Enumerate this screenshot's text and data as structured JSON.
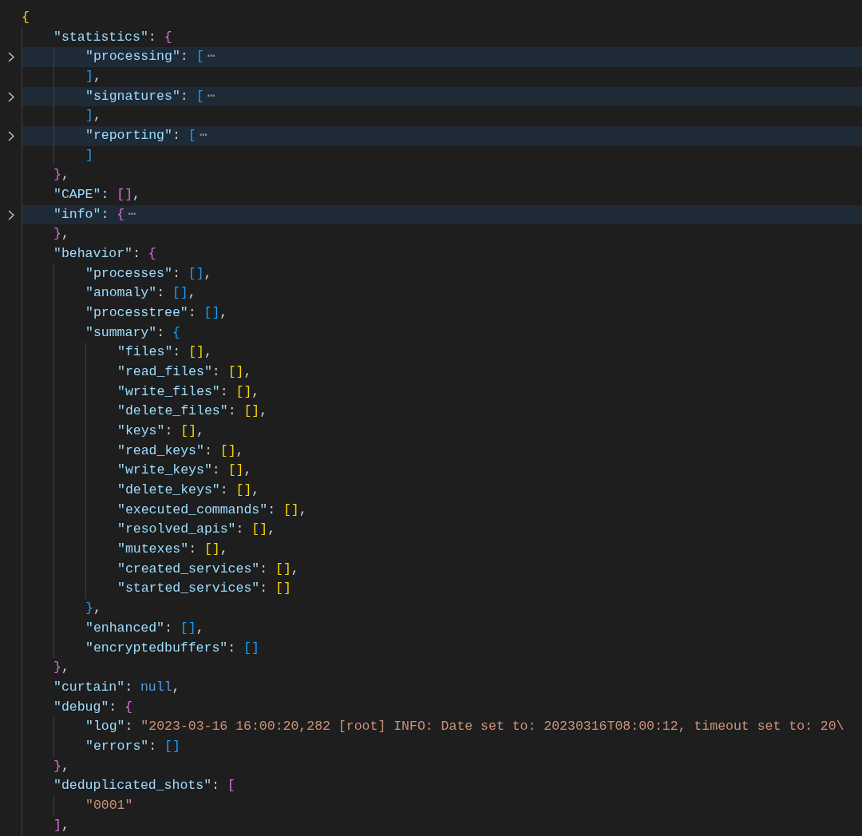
{
  "editor": {
    "lines": [
      {
        "folded": false,
        "tokens": [
          {
            "kind": "bracket",
            "text": "{",
            "color": "#ffd700"
          }
        ],
        "children": [
          {
            "folded": false,
            "tokens": [
              {
                "kind": "key",
                "text": "\"statistics\""
              },
              {
                "kind": "punct",
                "text": ": "
              },
              {
                "kind": "bracket",
                "text": "{",
                "color": "#da70d6"
              }
            ],
            "children": [
              {
                "folded": true,
                "tokens": [
                  {
                    "kind": "key",
                    "text": "\"processing\""
                  },
                  {
                    "kind": "punct",
                    "text": ": "
                  },
                  {
                    "kind": "bracket",
                    "text": "[",
                    "color": "#179fff"
                  },
                  {
                    "kind": "ellipsis",
                    "text": "⋯"
                  }
                ],
                "end": [
                  {
                    "kind": "bracket",
                    "text": "]",
                    "color": "#179fff"
                  },
                  {
                    "kind": "punct",
                    "text": ","
                  }
                ]
              },
              {
                "folded": true,
                "tokens": [
                  {
                    "kind": "key",
                    "text": "\"signatures\""
                  },
                  {
                    "kind": "punct",
                    "text": ": "
                  },
                  {
                    "kind": "bracket",
                    "text": "[",
                    "color": "#179fff"
                  },
                  {
                    "kind": "ellipsis",
                    "text": "⋯"
                  }
                ],
                "end": [
                  {
                    "kind": "bracket",
                    "text": "]",
                    "color": "#179fff"
                  },
                  {
                    "kind": "punct",
                    "text": ","
                  }
                ]
              },
              {
                "folded": true,
                "tokens": [
                  {
                    "kind": "key",
                    "text": "\"reporting\""
                  },
                  {
                    "kind": "punct",
                    "text": ": "
                  },
                  {
                    "kind": "bracket",
                    "text": "[",
                    "color": "#179fff"
                  },
                  {
                    "kind": "ellipsis",
                    "text": "⋯"
                  }
                ],
                "end": [
                  {
                    "kind": "bracket",
                    "text": "]",
                    "color": "#179fff"
                  }
                ]
              }
            ],
            "end": [
              {
                "kind": "bracket",
                "text": "}",
                "color": "#da70d6"
              },
              {
                "kind": "punct",
                "text": ","
              }
            ]
          },
          {
            "folded": false,
            "tokens": [
              {
                "kind": "key",
                "text": "\"CAPE\""
              },
              {
                "kind": "punct",
                "text": ": "
              },
              {
                "kind": "bracket",
                "text": "[]",
                "color": "#da70d6"
              },
              {
                "kind": "punct",
                "text": ","
              }
            ]
          },
          {
            "folded": true,
            "tokens": [
              {
                "kind": "key",
                "text": "\"info\""
              },
              {
                "kind": "punct",
                "text": ": "
              },
              {
                "kind": "bracket",
                "text": "{",
                "color": "#da70d6"
              },
              {
                "kind": "ellipsis",
                "text": "⋯"
              }
            ],
            "end": [
              {
                "kind": "bracket",
                "text": "}",
                "color": "#da70d6"
              },
              {
                "kind": "punct",
                "text": ","
              }
            ]
          },
          {
            "folded": false,
            "tokens": [
              {
                "kind": "key",
                "text": "\"behavior\""
              },
              {
                "kind": "punct",
                "text": ": "
              },
              {
                "kind": "bracket",
                "text": "{",
                "color": "#da70d6"
              }
            ],
            "children": [
              {
                "folded": false,
                "tokens": [
                  {
                    "kind": "key",
                    "text": "\"processes\""
                  },
                  {
                    "kind": "punct",
                    "text": ": "
                  },
                  {
                    "kind": "bracket",
                    "text": "[]",
                    "color": "#179fff"
                  },
                  {
                    "kind": "punct",
                    "text": ","
                  }
                ]
              },
              {
                "folded": false,
                "tokens": [
                  {
                    "kind": "key",
                    "text": "\"anomaly\""
                  },
                  {
                    "kind": "punct",
                    "text": ": "
                  },
                  {
                    "kind": "bracket",
                    "text": "[]",
                    "color": "#179fff"
                  },
                  {
                    "kind": "punct",
                    "text": ","
                  }
                ]
              },
              {
                "folded": false,
                "tokens": [
                  {
                    "kind": "key",
                    "text": "\"processtree\""
                  },
                  {
                    "kind": "punct",
                    "text": ": "
                  },
                  {
                    "kind": "bracket",
                    "text": "[]",
                    "color": "#179fff"
                  },
                  {
                    "kind": "punct",
                    "text": ","
                  }
                ]
              },
              {
                "folded": false,
                "tokens": [
                  {
                    "kind": "key",
                    "text": "\"summary\""
                  },
                  {
                    "kind": "punct",
                    "text": ": "
                  },
                  {
                    "kind": "bracket",
                    "text": "{",
                    "color": "#179fff"
                  }
                ],
                "children": [
                  {
                    "folded": false,
                    "tokens": [
                      {
                        "kind": "key",
                        "text": "\"files\""
                      },
                      {
                        "kind": "punct",
                        "text": ": "
                      },
                      {
                        "kind": "bracket",
                        "text": "[]",
                        "color": "#ffd700"
                      },
                      {
                        "kind": "punct",
                        "text": ","
                      }
                    ]
                  },
                  {
                    "folded": false,
                    "tokens": [
                      {
                        "kind": "key",
                        "text": "\"read_files\""
                      },
                      {
                        "kind": "punct",
                        "text": ": "
                      },
                      {
                        "kind": "bracket",
                        "text": "[]",
                        "color": "#ffd700"
                      },
                      {
                        "kind": "punct",
                        "text": ","
                      }
                    ]
                  },
                  {
                    "folded": false,
                    "tokens": [
                      {
                        "kind": "key",
                        "text": "\"write_files\""
                      },
                      {
                        "kind": "punct",
                        "text": ": "
                      },
                      {
                        "kind": "bracket",
                        "text": "[]",
                        "color": "#ffd700"
                      },
                      {
                        "kind": "punct",
                        "text": ","
                      }
                    ]
                  },
                  {
                    "folded": false,
                    "tokens": [
                      {
                        "kind": "key",
                        "text": "\"delete_files\""
                      },
                      {
                        "kind": "punct",
                        "text": ": "
                      },
                      {
                        "kind": "bracket",
                        "text": "[]",
                        "color": "#ffd700"
                      },
                      {
                        "kind": "punct",
                        "text": ","
                      }
                    ]
                  },
                  {
                    "folded": false,
                    "tokens": [
                      {
                        "kind": "key",
                        "text": "\"keys\""
                      },
                      {
                        "kind": "punct",
                        "text": ": "
                      },
                      {
                        "kind": "bracket",
                        "text": "[]",
                        "color": "#ffd700"
                      },
                      {
                        "kind": "punct",
                        "text": ","
                      }
                    ]
                  },
                  {
                    "folded": false,
                    "tokens": [
                      {
                        "kind": "key",
                        "text": "\"read_keys\""
                      },
                      {
                        "kind": "punct",
                        "text": ": "
                      },
                      {
                        "kind": "bracket",
                        "text": "[]",
                        "color": "#ffd700"
                      },
                      {
                        "kind": "punct",
                        "text": ","
                      }
                    ]
                  },
                  {
                    "folded": false,
                    "tokens": [
                      {
                        "kind": "key",
                        "text": "\"write_keys\""
                      },
                      {
                        "kind": "punct",
                        "text": ": "
                      },
                      {
                        "kind": "bracket",
                        "text": "[]",
                        "color": "#ffd700"
                      },
                      {
                        "kind": "punct",
                        "text": ","
                      }
                    ]
                  },
                  {
                    "folded": false,
                    "tokens": [
                      {
                        "kind": "key",
                        "text": "\"delete_keys\""
                      },
                      {
                        "kind": "punct",
                        "text": ": "
                      },
                      {
                        "kind": "bracket",
                        "text": "[]",
                        "color": "#ffd700"
                      },
                      {
                        "kind": "punct",
                        "text": ","
                      }
                    ]
                  },
                  {
                    "folded": false,
                    "tokens": [
                      {
                        "kind": "key",
                        "text": "\"executed_commands\""
                      },
                      {
                        "kind": "punct",
                        "text": ": "
                      },
                      {
                        "kind": "bracket",
                        "text": "[]",
                        "color": "#ffd700"
                      },
                      {
                        "kind": "punct",
                        "text": ","
                      }
                    ]
                  },
                  {
                    "folded": false,
                    "tokens": [
                      {
                        "kind": "key",
                        "text": "\"resolved_apis\""
                      },
                      {
                        "kind": "punct",
                        "text": ": "
                      },
                      {
                        "kind": "bracket",
                        "text": "[]",
                        "color": "#ffd700"
                      },
                      {
                        "kind": "punct",
                        "text": ","
                      }
                    ]
                  },
                  {
                    "folded": false,
                    "tokens": [
                      {
                        "kind": "key",
                        "text": "\"mutexes\""
                      },
                      {
                        "kind": "punct",
                        "text": ": "
                      },
                      {
                        "kind": "bracket",
                        "text": "[]",
                        "color": "#ffd700"
                      },
                      {
                        "kind": "punct",
                        "text": ","
                      }
                    ]
                  },
                  {
                    "folded": false,
                    "tokens": [
                      {
                        "kind": "key",
                        "text": "\"created_services\""
                      },
                      {
                        "kind": "punct",
                        "text": ": "
                      },
                      {
                        "kind": "bracket",
                        "text": "[]",
                        "color": "#ffd700"
                      },
                      {
                        "kind": "punct",
                        "text": ","
                      }
                    ]
                  },
                  {
                    "folded": false,
                    "tokens": [
                      {
                        "kind": "key",
                        "text": "\"started_services\""
                      },
                      {
                        "kind": "punct",
                        "text": ": "
                      },
                      {
                        "kind": "bracket",
                        "text": "[]",
                        "color": "#ffd700"
                      }
                    ]
                  }
                ],
                "end": [
                  {
                    "kind": "bracket",
                    "text": "}",
                    "color": "#179fff"
                  },
                  {
                    "kind": "punct",
                    "text": ","
                  }
                ]
              },
              {
                "folded": false,
                "tokens": [
                  {
                    "kind": "key",
                    "text": "\"enhanced\""
                  },
                  {
                    "kind": "punct",
                    "text": ": "
                  },
                  {
                    "kind": "bracket",
                    "text": "[]",
                    "color": "#179fff"
                  },
                  {
                    "kind": "punct",
                    "text": ","
                  }
                ]
              },
              {
                "folded": false,
                "tokens": [
                  {
                    "kind": "key",
                    "text": "\"encryptedbuffers\""
                  },
                  {
                    "kind": "punct",
                    "text": ": "
                  },
                  {
                    "kind": "bracket",
                    "text": "[]",
                    "color": "#179fff"
                  }
                ]
              }
            ],
            "end": [
              {
                "kind": "bracket",
                "text": "}",
                "color": "#da70d6"
              },
              {
                "kind": "punct",
                "text": ","
              }
            ]
          },
          {
            "folded": false,
            "tokens": [
              {
                "kind": "key",
                "text": "\"curtain\""
              },
              {
                "kind": "punct",
                "text": ": "
              },
              {
                "kind": "keyword",
                "text": "null"
              },
              {
                "kind": "punct",
                "text": ","
              }
            ]
          },
          {
            "folded": false,
            "tokens": [
              {
                "kind": "key",
                "text": "\"debug\""
              },
              {
                "kind": "punct",
                "text": ": "
              },
              {
                "kind": "bracket",
                "text": "{",
                "color": "#da70d6"
              }
            ],
            "children": [
              {
                "folded": false,
                "tokens": [
                  {
                    "kind": "key",
                    "text": "\"log\""
                  },
                  {
                    "kind": "punct",
                    "text": ": "
                  },
                  {
                    "kind": "string",
                    "text": "\"2023-03-16 16:00:20,282 [root] INFO: Date set to: 20230316T08:00:12, timeout set to: 20\\"
                  }
                ]
              },
              {
                "folded": false,
                "tokens": [
                  {
                    "kind": "key",
                    "text": "\"errors\""
                  },
                  {
                    "kind": "punct",
                    "text": ": "
                  },
                  {
                    "kind": "bracket",
                    "text": "[]",
                    "color": "#179fff"
                  }
                ]
              }
            ],
            "end": [
              {
                "kind": "bracket",
                "text": "}",
                "color": "#da70d6"
              },
              {
                "kind": "punct",
                "text": ","
              }
            ]
          },
          {
            "folded": false,
            "tokens": [
              {
                "kind": "key",
                "text": "\"deduplicated_shots\""
              },
              {
                "kind": "punct",
                "text": ": "
              },
              {
                "kind": "bracket",
                "text": "[",
                "color": "#da70d6"
              }
            ],
            "children": [
              {
                "folded": false,
                "tokens": [
                  {
                    "kind": "string",
                    "text": "\"0001\""
                  }
                ]
              }
            ],
            "end": [
              {
                "kind": "bracket",
                "text": "]",
                "color": "#da70d6"
              },
              {
                "kind": "punct",
                "text": ","
              }
            ]
          }
        ]
      }
    ]
  }
}
